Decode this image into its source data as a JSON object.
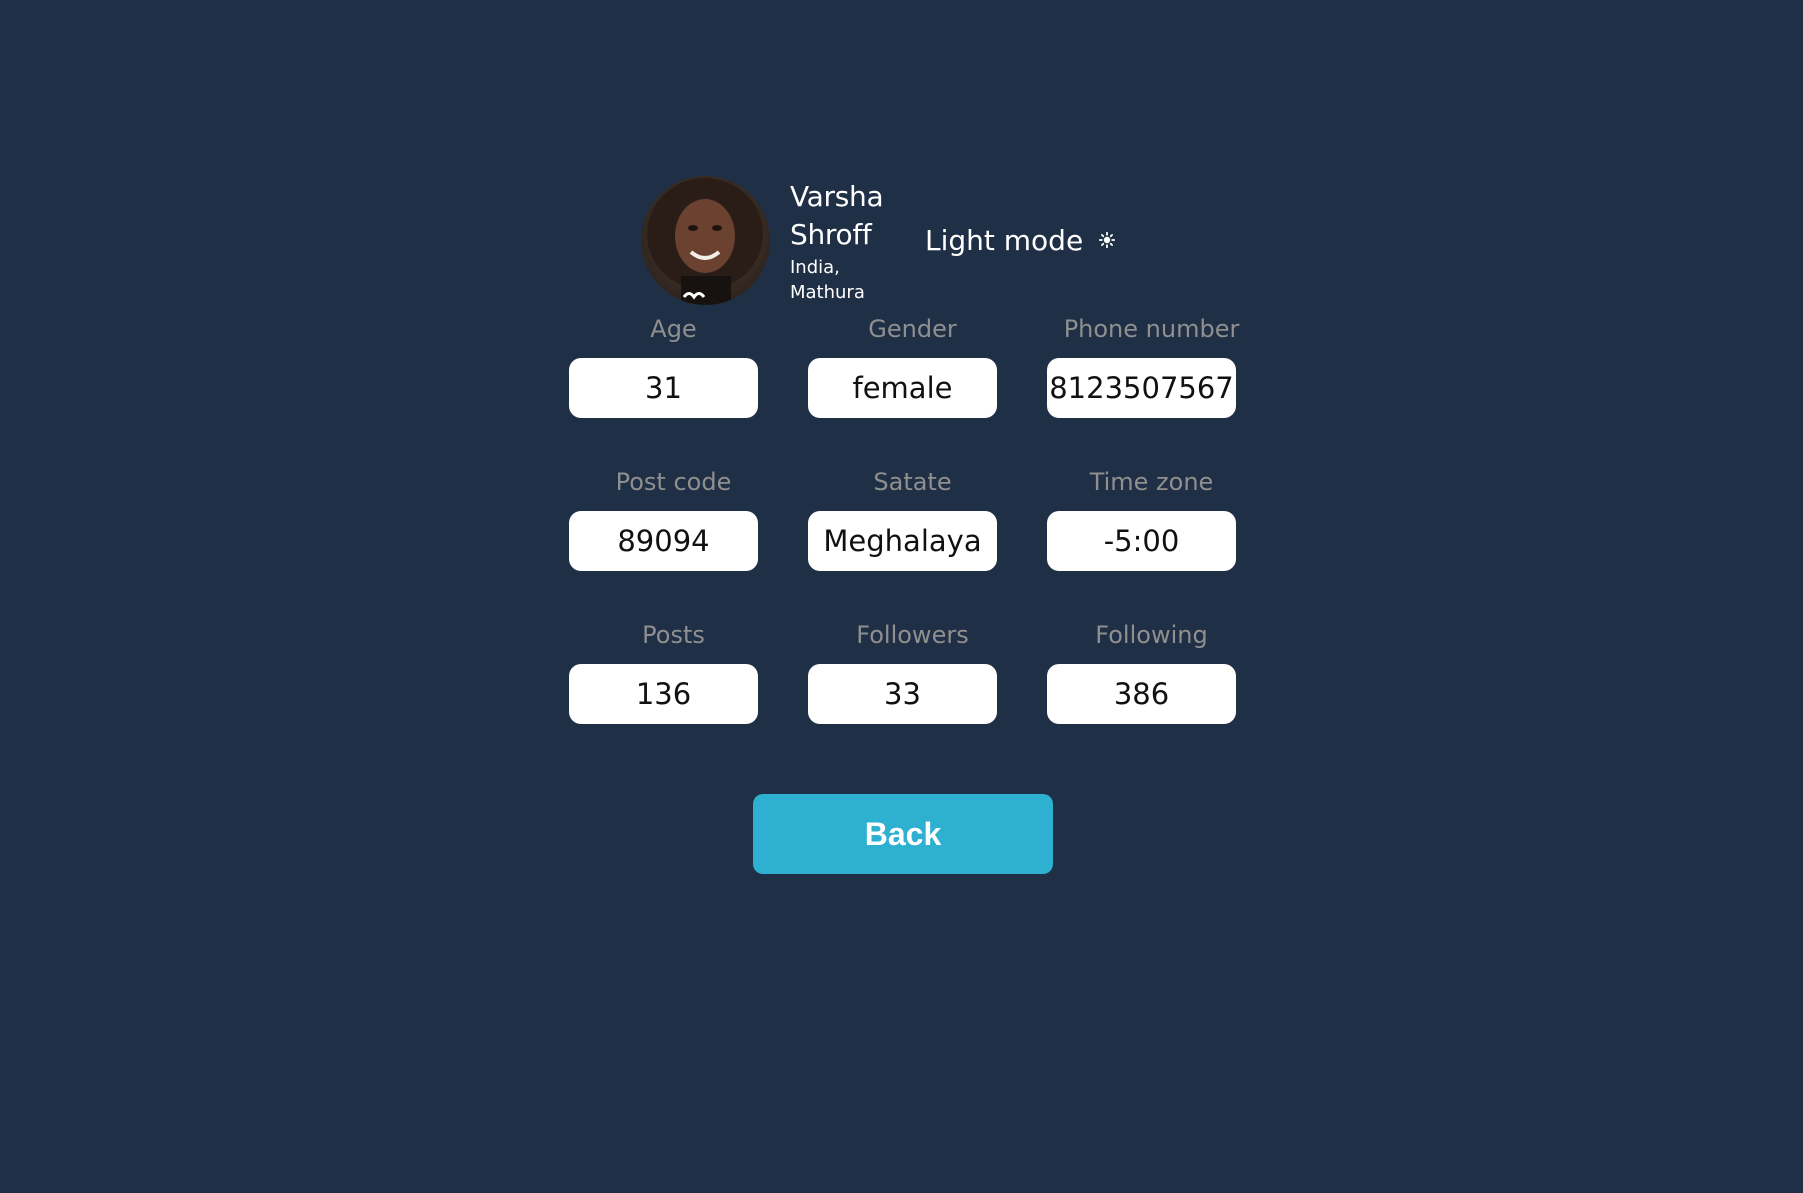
{
  "profile": {
    "first_name": "Varsha",
    "last_name": "Shroff",
    "country": "India,",
    "city": "Mathura",
    "avatar_icon": "user-photo"
  },
  "mode_toggle": {
    "label": "Light mode",
    "icon": "☀",
    "icon_name": "sun-icon"
  },
  "fields": [
    {
      "label": "Age",
      "value": "31"
    },
    {
      "label": "Gender",
      "value": "female"
    },
    {
      "label": "Phone number",
      "value": "8123507567"
    },
    {
      "label": "Post code",
      "value": "89094"
    },
    {
      "label": "Satate",
      "value": "Meghalaya"
    },
    {
      "label": "Time zone",
      "value": "-5:00"
    },
    {
      "label": "Posts",
      "value": "136"
    },
    {
      "label": "Followers",
      "value": "33"
    },
    {
      "label": "Following",
      "value": "386"
    }
  ],
  "back_button": {
    "label": "Back"
  },
  "colors": {
    "background": "#1f2f45",
    "label_gray": "#8f8f8f",
    "field_bg": "#ffffff",
    "button_accent": "#2eb1d0"
  }
}
